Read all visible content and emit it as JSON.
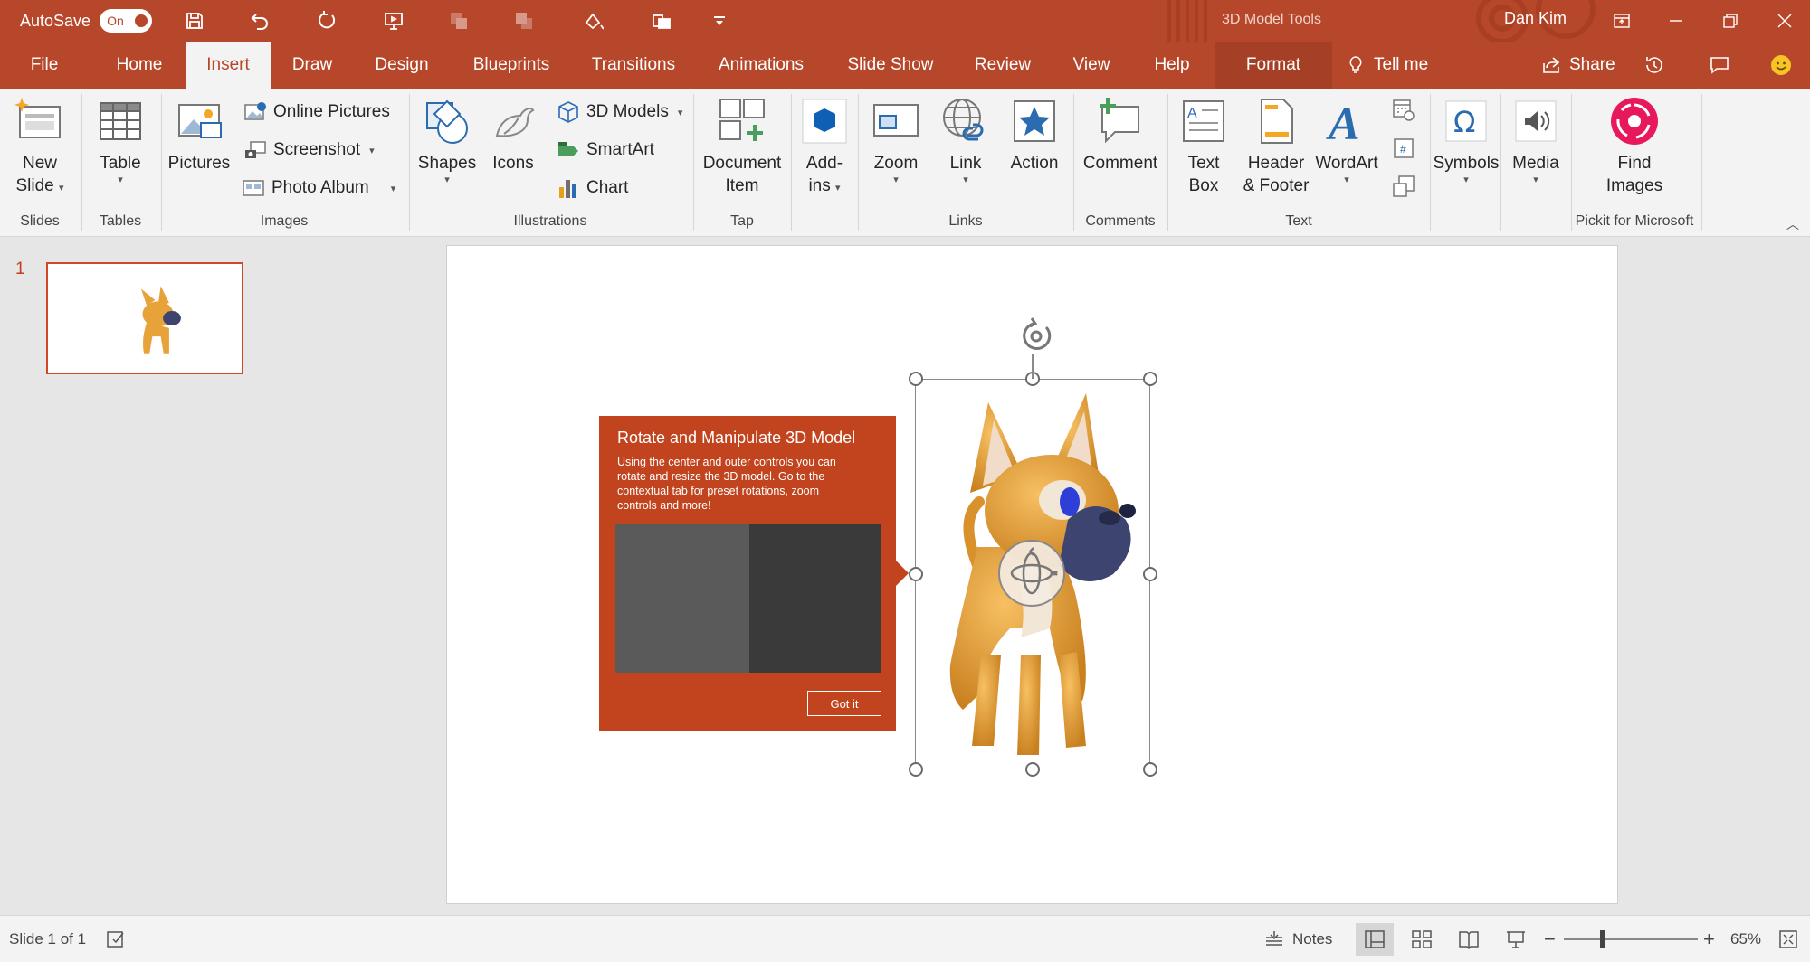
{
  "titlebar": {
    "autosave_label": "AutoSave",
    "autosave_state": "On",
    "context_title": "3D Model Tools",
    "user": "Dan Kim"
  },
  "tabs": [
    "File",
    "Home",
    "Insert",
    "Draw",
    "Design",
    "Blueprints",
    "Transitions",
    "Animations",
    "Slide Show",
    "Review",
    "View",
    "Help",
    "Format"
  ],
  "active_tab": "Insert",
  "tell_me": "Tell me",
  "share": "Share",
  "ribbon": {
    "new_slide": [
      "New",
      "Slide"
    ],
    "table": "Table",
    "pictures": "Pictures",
    "online_pictures": "Online Pictures",
    "screenshot": "Screenshot",
    "photo_album": "Photo Album",
    "shapes": "Shapes",
    "icons": "Icons",
    "models_3d": "3D Models",
    "smartart": "SmartArt",
    "chart": "Chart",
    "document_item": [
      "Document",
      "Item"
    ],
    "add_ins": [
      "Add-",
      "ins"
    ],
    "zoom": "Zoom",
    "link": "Link",
    "action": "Action",
    "comment": "Comment",
    "text_box": [
      "Text",
      "Box"
    ],
    "header_footer": [
      "Header",
      "& Footer"
    ],
    "wordart": "WordArt",
    "symbols": "Symbols",
    "media": "Media",
    "find_images": [
      "Find",
      "Images"
    ],
    "groups": {
      "slides": "Slides",
      "tables": "Tables",
      "images": "Images",
      "illustrations": "Illustrations",
      "tap": "Tap",
      "links": "Links",
      "comments": "Comments",
      "text": "Text",
      "pickit": "Pickit for Microsoft"
    }
  },
  "slides_pane": {
    "slide_number": "1"
  },
  "callout": {
    "title": "Rotate and Manipulate 3D Model",
    "body": "Using the center and outer controls you can rotate and resize the 3D model. Go to the contextual tab for preset rotations, zoom controls and more!",
    "button": "Got it"
  },
  "statusbar": {
    "slide_info": "Slide 1 of 1",
    "notes": "Notes",
    "zoom": "65%",
    "zoom_minus": "−",
    "zoom_plus": "+"
  },
  "colors": {
    "accent": "#b7472a",
    "callout": "#c1441f",
    "dog": "#e8a23a"
  }
}
